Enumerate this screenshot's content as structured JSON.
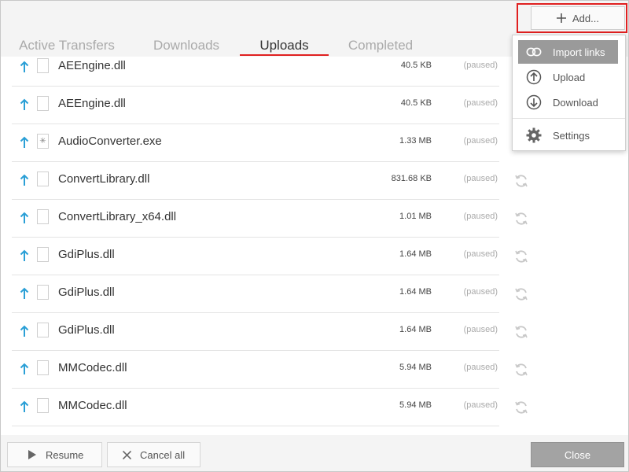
{
  "header": {
    "add_label": "Add..."
  },
  "tabs": [
    {
      "label": "Active Transfers"
    },
    {
      "label": "Downloads"
    },
    {
      "label": "Uploads"
    },
    {
      "label": "Completed"
    }
  ],
  "active_tab": "Uploads",
  "files": [
    {
      "name": "AEEngine.dll",
      "size": "40.5 KB",
      "status": "(paused)"
    },
    {
      "name": "AEEngine.dll",
      "size": "40.5 KB",
      "status": "(paused)"
    },
    {
      "name": "AudioConverter.exe",
      "size": "1.33 MB",
      "status": "(paused)"
    },
    {
      "name": "ConvertLibrary.dll",
      "size": "831.68 KB",
      "status": "(paused)"
    },
    {
      "name": "ConvertLibrary_x64.dll",
      "size": "1.01 MB",
      "status": "(paused)"
    },
    {
      "name": "GdiPlus.dll",
      "size": "1.64 MB",
      "status": "(paused)"
    },
    {
      "name": "GdiPlus.dll",
      "size": "1.64 MB",
      "status": "(paused)"
    },
    {
      "name": "GdiPlus.dll",
      "size": "1.64 MB",
      "status": "(paused)"
    },
    {
      "name": "MMCodec.dll",
      "size": "5.94 MB",
      "status": "(paused)"
    },
    {
      "name": "MMCodec.dll",
      "size": "5.94 MB",
      "status": "(paused)"
    }
  ],
  "menu": {
    "import_links": "Import links",
    "upload": "Upload",
    "download": "Download",
    "settings": "Settings"
  },
  "footer": {
    "resume": "Resume",
    "cancel_all": "Cancel all",
    "close": "Close"
  },
  "colors": {
    "accent": "#e02020",
    "upload_arrow": "#2a9fd6",
    "menu_highlight": "#9a9a9a"
  }
}
